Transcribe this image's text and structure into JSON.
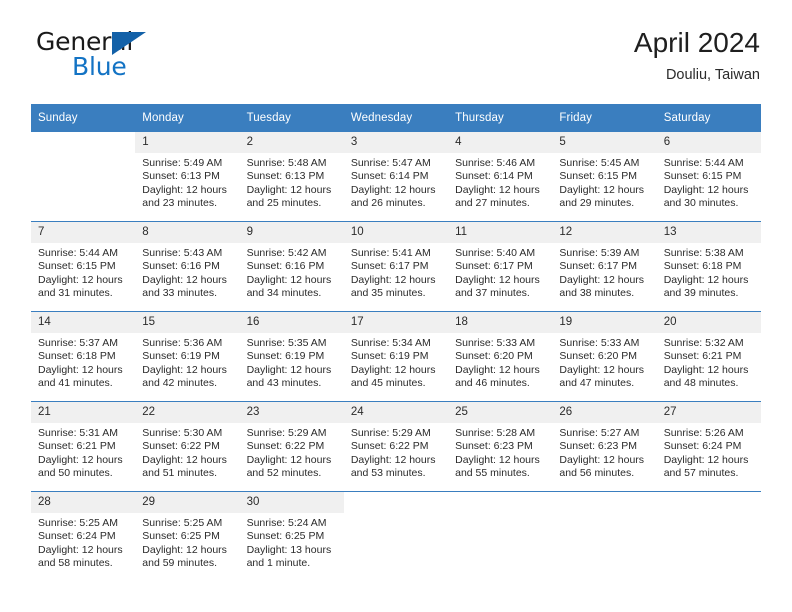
{
  "brand": {
    "name_line1": "General",
    "name_line2": "Blue",
    "flag_icon": "triangle-flag-icon",
    "accent_color": "#1373c4",
    "flag_color": "#1361a8"
  },
  "header": {
    "title": "April 2024",
    "subtitle": "Douliu, Taiwan"
  },
  "theme": {
    "header_row_color": "#3a7ebf",
    "daynum_band_color": "#f0f0f0",
    "grid_line_color": "#3a7ebf",
    "text_color": "#2b2b2b"
  },
  "weekdays": [
    "Sunday",
    "Monday",
    "Tuesday",
    "Wednesday",
    "Thursday",
    "Friday",
    "Saturday"
  ],
  "weeks": [
    [
      {
        "day": "",
        "blank": true,
        "sunrise": "",
        "sunset": "",
        "daylight_line1": "",
        "daylight_line2": ""
      },
      {
        "day": "1",
        "sunrise": "Sunrise: 5:49 AM",
        "sunset": "Sunset: 6:13 PM",
        "daylight_line1": "Daylight: 12 hours",
        "daylight_line2": "and 23 minutes."
      },
      {
        "day": "2",
        "sunrise": "Sunrise: 5:48 AM",
        "sunset": "Sunset: 6:13 PM",
        "daylight_line1": "Daylight: 12 hours",
        "daylight_line2": "and 25 minutes."
      },
      {
        "day": "3",
        "sunrise": "Sunrise: 5:47 AM",
        "sunset": "Sunset: 6:14 PM",
        "daylight_line1": "Daylight: 12 hours",
        "daylight_line2": "and 26 minutes."
      },
      {
        "day": "4",
        "sunrise": "Sunrise: 5:46 AM",
        "sunset": "Sunset: 6:14 PM",
        "daylight_line1": "Daylight: 12 hours",
        "daylight_line2": "and 27 minutes."
      },
      {
        "day": "5",
        "sunrise": "Sunrise: 5:45 AM",
        "sunset": "Sunset: 6:15 PM",
        "daylight_line1": "Daylight: 12 hours",
        "daylight_line2": "and 29 minutes."
      },
      {
        "day": "6",
        "sunrise": "Sunrise: 5:44 AM",
        "sunset": "Sunset: 6:15 PM",
        "daylight_line1": "Daylight: 12 hours",
        "daylight_line2": "and 30 minutes."
      }
    ],
    [
      {
        "day": "7",
        "sunrise": "Sunrise: 5:44 AM",
        "sunset": "Sunset: 6:15 PM",
        "daylight_line1": "Daylight: 12 hours",
        "daylight_line2": "and 31 minutes."
      },
      {
        "day": "8",
        "sunrise": "Sunrise: 5:43 AM",
        "sunset": "Sunset: 6:16 PM",
        "daylight_line1": "Daylight: 12 hours",
        "daylight_line2": "and 33 minutes."
      },
      {
        "day": "9",
        "sunrise": "Sunrise: 5:42 AM",
        "sunset": "Sunset: 6:16 PM",
        "daylight_line1": "Daylight: 12 hours",
        "daylight_line2": "and 34 minutes."
      },
      {
        "day": "10",
        "sunrise": "Sunrise: 5:41 AM",
        "sunset": "Sunset: 6:17 PM",
        "daylight_line1": "Daylight: 12 hours",
        "daylight_line2": "and 35 minutes."
      },
      {
        "day": "11",
        "sunrise": "Sunrise: 5:40 AM",
        "sunset": "Sunset: 6:17 PM",
        "daylight_line1": "Daylight: 12 hours",
        "daylight_line2": "and 37 minutes."
      },
      {
        "day": "12",
        "sunrise": "Sunrise: 5:39 AM",
        "sunset": "Sunset: 6:17 PM",
        "daylight_line1": "Daylight: 12 hours",
        "daylight_line2": "and 38 minutes."
      },
      {
        "day": "13",
        "sunrise": "Sunrise: 5:38 AM",
        "sunset": "Sunset: 6:18 PM",
        "daylight_line1": "Daylight: 12 hours",
        "daylight_line2": "and 39 minutes."
      }
    ],
    [
      {
        "day": "14",
        "sunrise": "Sunrise: 5:37 AM",
        "sunset": "Sunset: 6:18 PM",
        "daylight_line1": "Daylight: 12 hours",
        "daylight_line2": "and 41 minutes."
      },
      {
        "day": "15",
        "sunrise": "Sunrise: 5:36 AM",
        "sunset": "Sunset: 6:19 PM",
        "daylight_line1": "Daylight: 12 hours",
        "daylight_line2": "and 42 minutes."
      },
      {
        "day": "16",
        "sunrise": "Sunrise: 5:35 AM",
        "sunset": "Sunset: 6:19 PM",
        "daylight_line1": "Daylight: 12 hours",
        "daylight_line2": "and 43 minutes."
      },
      {
        "day": "17",
        "sunrise": "Sunrise: 5:34 AM",
        "sunset": "Sunset: 6:19 PM",
        "daylight_line1": "Daylight: 12 hours",
        "daylight_line2": "and 45 minutes."
      },
      {
        "day": "18",
        "sunrise": "Sunrise: 5:33 AM",
        "sunset": "Sunset: 6:20 PM",
        "daylight_line1": "Daylight: 12 hours",
        "daylight_line2": "and 46 minutes."
      },
      {
        "day": "19",
        "sunrise": "Sunrise: 5:33 AM",
        "sunset": "Sunset: 6:20 PM",
        "daylight_line1": "Daylight: 12 hours",
        "daylight_line2": "and 47 minutes."
      },
      {
        "day": "20",
        "sunrise": "Sunrise: 5:32 AM",
        "sunset": "Sunset: 6:21 PM",
        "daylight_line1": "Daylight: 12 hours",
        "daylight_line2": "and 48 minutes."
      }
    ],
    [
      {
        "day": "21",
        "sunrise": "Sunrise: 5:31 AM",
        "sunset": "Sunset: 6:21 PM",
        "daylight_line1": "Daylight: 12 hours",
        "daylight_line2": "and 50 minutes."
      },
      {
        "day": "22",
        "sunrise": "Sunrise: 5:30 AM",
        "sunset": "Sunset: 6:22 PM",
        "daylight_line1": "Daylight: 12 hours",
        "daylight_line2": "and 51 minutes."
      },
      {
        "day": "23",
        "sunrise": "Sunrise: 5:29 AM",
        "sunset": "Sunset: 6:22 PM",
        "daylight_line1": "Daylight: 12 hours",
        "daylight_line2": "and 52 minutes."
      },
      {
        "day": "24",
        "sunrise": "Sunrise: 5:29 AM",
        "sunset": "Sunset: 6:22 PM",
        "daylight_line1": "Daylight: 12 hours",
        "daylight_line2": "and 53 minutes."
      },
      {
        "day": "25",
        "sunrise": "Sunrise: 5:28 AM",
        "sunset": "Sunset: 6:23 PM",
        "daylight_line1": "Daylight: 12 hours",
        "daylight_line2": "and 55 minutes."
      },
      {
        "day": "26",
        "sunrise": "Sunrise: 5:27 AM",
        "sunset": "Sunset: 6:23 PM",
        "daylight_line1": "Daylight: 12 hours",
        "daylight_line2": "and 56 minutes."
      },
      {
        "day": "27",
        "sunrise": "Sunrise: 5:26 AM",
        "sunset": "Sunset: 6:24 PM",
        "daylight_line1": "Daylight: 12 hours",
        "daylight_line2": "and 57 minutes."
      }
    ],
    [
      {
        "day": "28",
        "sunrise": "Sunrise: 5:25 AM",
        "sunset": "Sunset: 6:24 PM",
        "daylight_line1": "Daylight: 12 hours",
        "daylight_line2": "and 58 minutes."
      },
      {
        "day": "29",
        "sunrise": "Sunrise: 5:25 AM",
        "sunset": "Sunset: 6:25 PM",
        "daylight_line1": "Daylight: 12 hours",
        "daylight_line2": "and 59 minutes."
      },
      {
        "day": "30",
        "sunrise": "Sunrise: 5:24 AM",
        "sunset": "Sunset: 6:25 PM",
        "daylight_line1": "Daylight: 13 hours",
        "daylight_line2": "and 1 minute."
      },
      {
        "day": "",
        "blank": true,
        "sunrise": "",
        "sunset": "",
        "daylight_line1": "",
        "daylight_line2": ""
      },
      {
        "day": "",
        "blank": true,
        "sunrise": "",
        "sunset": "",
        "daylight_line1": "",
        "daylight_line2": ""
      },
      {
        "day": "",
        "blank": true,
        "sunrise": "",
        "sunset": "",
        "daylight_line1": "",
        "daylight_line2": ""
      },
      {
        "day": "",
        "blank": true,
        "sunrise": "",
        "sunset": "",
        "daylight_line1": "",
        "daylight_line2": ""
      }
    ]
  ]
}
